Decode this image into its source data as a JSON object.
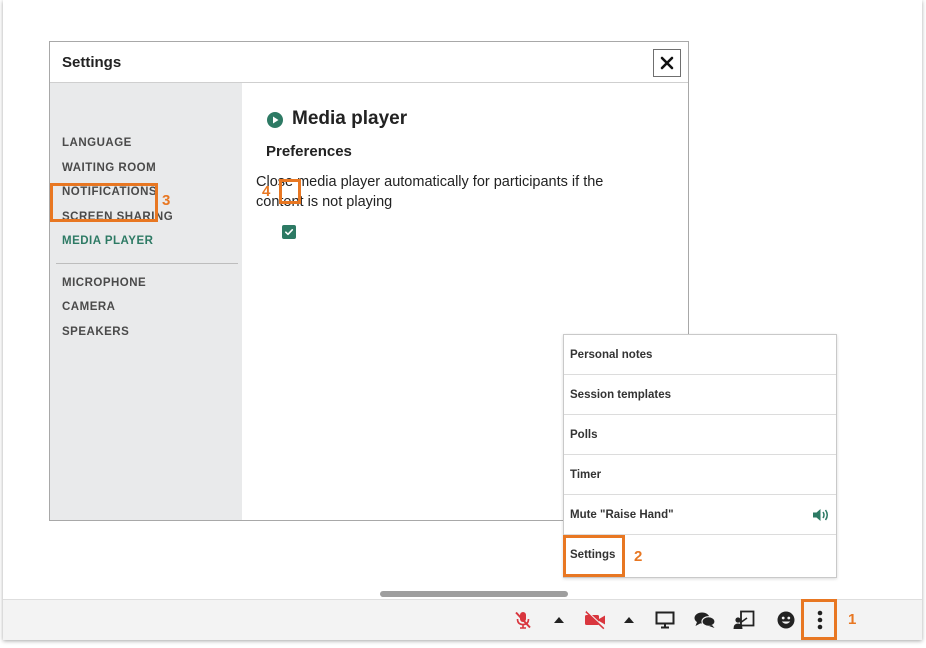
{
  "dialog": {
    "title": "Settings",
    "nav": [
      "LANGUAGE",
      "WAITING ROOM",
      "NOTIFICATIONS",
      "SCREEN SHARING",
      "MEDIA PLAYER",
      "MICROPHONE",
      "CAMERA",
      "SPEAKERS"
    ],
    "active_nav": "MEDIA PLAYER",
    "content_title": "Media player",
    "preferences_title": "Preferences",
    "checkbox_label": "Close media player automatically for participants if the content is not playing",
    "checkbox_checked": true
  },
  "menu": {
    "items": [
      "Personal notes",
      "Session templates",
      "Polls",
      "Timer",
      "Mute \"Raise Hand\"",
      "Settings"
    ]
  },
  "callouts": [
    "1",
    "2",
    "3",
    "4"
  ],
  "colors": {
    "accent": "#2d7a64",
    "highlight": "#e87722",
    "mute_red": "#d9363e"
  },
  "toolbar": {
    "icons": [
      "microphone-muted-icon",
      "caret-up-icon",
      "camera-muted-icon",
      "caret-up-icon",
      "monitor-icon",
      "chat-icon",
      "presenter-icon",
      "emoji-icon",
      "more-vertical-icon"
    ]
  }
}
